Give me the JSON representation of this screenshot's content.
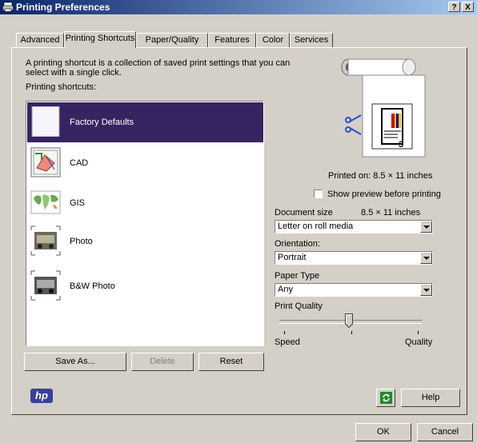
{
  "window": {
    "title": "Printing Preferences",
    "help_btn": "?",
    "close_btn": "X"
  },
  "tabs": [
    "Advanced",
    "Printing Shortcuts",
    "Paper/Quality",
    "Features",
    "Color",
    "Services"
  ],
  "active_tab": "Printing Shortcuts",
  "description": "A printing shortcut is a collection of saved print settings that you can select with a single click.",
  "shortcuts_label": "Printing shortcuts:",
  "shortcuts": [
    {
      "label": "Factory Defaults",
      "selected": true
    },
    {
      "label": "CAD",
      "selected": false
    },
    {
      "label": "GIS",
      "selected": false
    },
    {
      "label": "Photo",
      "selected": false
    },
    {
      "label": "B&W Photo",
      "selected": false
    }
  ],
  "buttons": {
    "save_as": "Save As...",
    "delete": "Delete",
    "reset": "Reset",
    "help": "Help",
    "ok": "OK",
    "cancel": "Cancel"
  },
  "printed_on": "Printed on: 8.5 × 11 inches",
  "show_preview": "Show preview before printing",
  "document_size": {
    "label": "Document size",
    "dimension": "8.5 × 11 inches",
    "value": "Letter on roll media"
  },
  "orientation": {
    "label": "Orientation:",
    "value": "Portrait"
  },
  "paper_type": {
    "label": "Paper Type",
    "value": "Any"
  },
  "print_quality": {
    "label": "Print Quality",
    "min_label": "Speed",
    "max_label": "Quality",
    "level": 0.5
  },
  "brand": "hp",
  "colors": {
    "title_start": "#0a246a",
    "title_end": "#a6caf0",
    "selection": "#362461",
    "face": "#d4d0c8"
  }
}
